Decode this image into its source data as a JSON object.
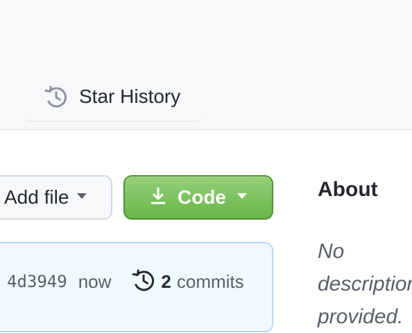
{
  "header": {
    "tab": {
      "label": "Star History",
      "icon": "history-clock-icon"
    }
  },
  "toolbar": {
    "add_file_label": "Add file",
    "add_file_icon": "chevron-down-icon",
    "code_label": "Code",
    "code_icons": {
      "leading": "download-icon",
      "trailing": "chevron-down-icon"
    }
  },
  "commit_info": {
    "hash": "4d3949",
    "time": "now",
    "count": "2",
    "count_label": "commits",
    "icon": "history-icon"
  },
  "sidebar": {
    "heading": "About",
    "description": "No description provided."
  },
  "colors": {
    "header_background": "#f6f8fa",
    "code_button_green": "#6ab548",
    "commit_box_background": "#f1f8ff",
    "commit_box_border": "#b6d8f8"
  }
}
